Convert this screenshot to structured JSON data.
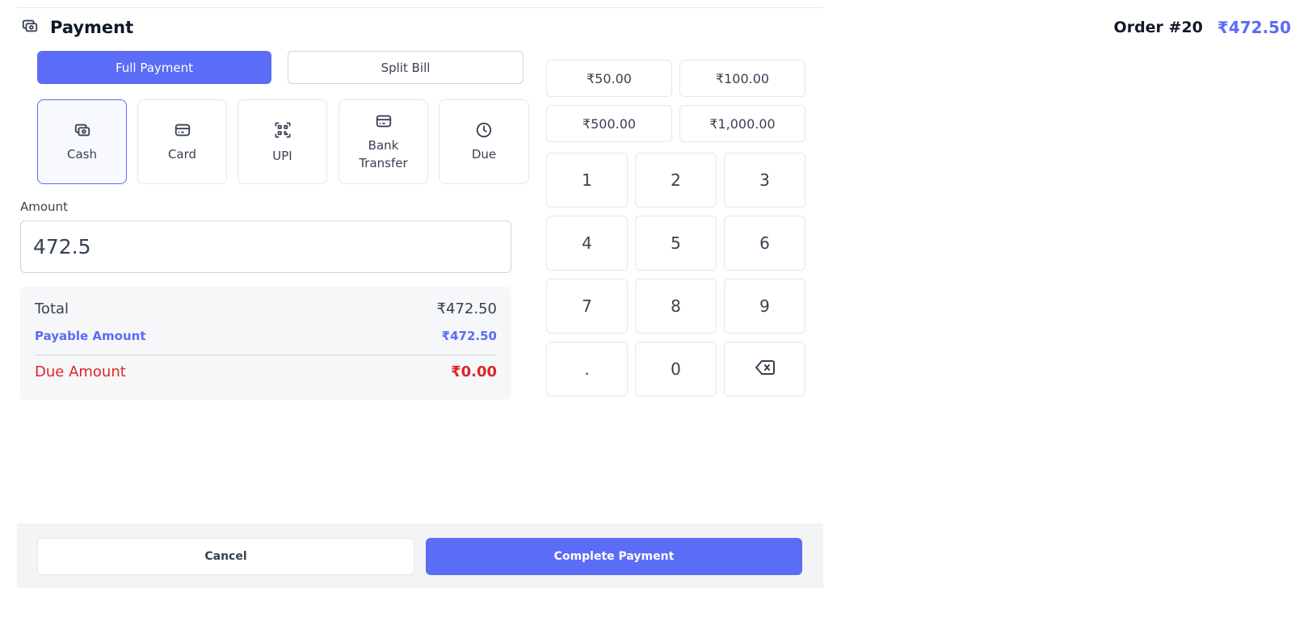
{
  "header": {
    "title": "Payment",
    "icon": "cash-icon",
    "order_label": "Order #20",
    "order_total": "₹472.50"
  },
  "payment_types": [
    {
      "label": "Full Payment",
      "active": true
    },
    {
      "label": "Split Bill",
      "active": false
    }
  ],
  "methods": [
    {
      "label": "Cash",
      "icon": "cash-icon",
      "selected": true
    },
    {
      "label": "Card",
      "icon": "card-icon",
      "selected": false
    },
    {
      "label": "UPI",
      "icon": "qr-code-icon",
      "selected": false
    },
    {
      "label": "Bank Transfer",
      "icon": "bank-card-icon",
      "selected": false
    },
    {
      "label": "Due",
      "icon": "clock-icon",
      "selected": false
    }
  ],
  "amount": {
    "label": "Amount",
    "value": "472.5"
  },
  "summary": {
    "total_label": "Total",
    "total_value": "₹472.50",
    "payable_label": "Payable Amount",
    "payable_value": "₹472.50",
    "due_label": "Due Amount",
    "due_value": "₹0.00"
  },
  "quick_amounts": [
    "₹50.00",
    "₹100.00",
    "₹500.00",
    "₹1,000.00"
  ],
  "keypad": [
    "1",
    "2",
    "3",
    "4",
    "5",
    "6",
    "7",
    "8",
    "9",
    ".",
    "0"
  ],
  "keypad_backspace_icon": "backspace-icon",
  "footer": {
    "cancel_label": "Cancel",
    "complete_label": "Complete Payment"
  },
  "colors": {
    "accent": "#5b6cf6",
    "danger": "#dc2626"
  }
}
